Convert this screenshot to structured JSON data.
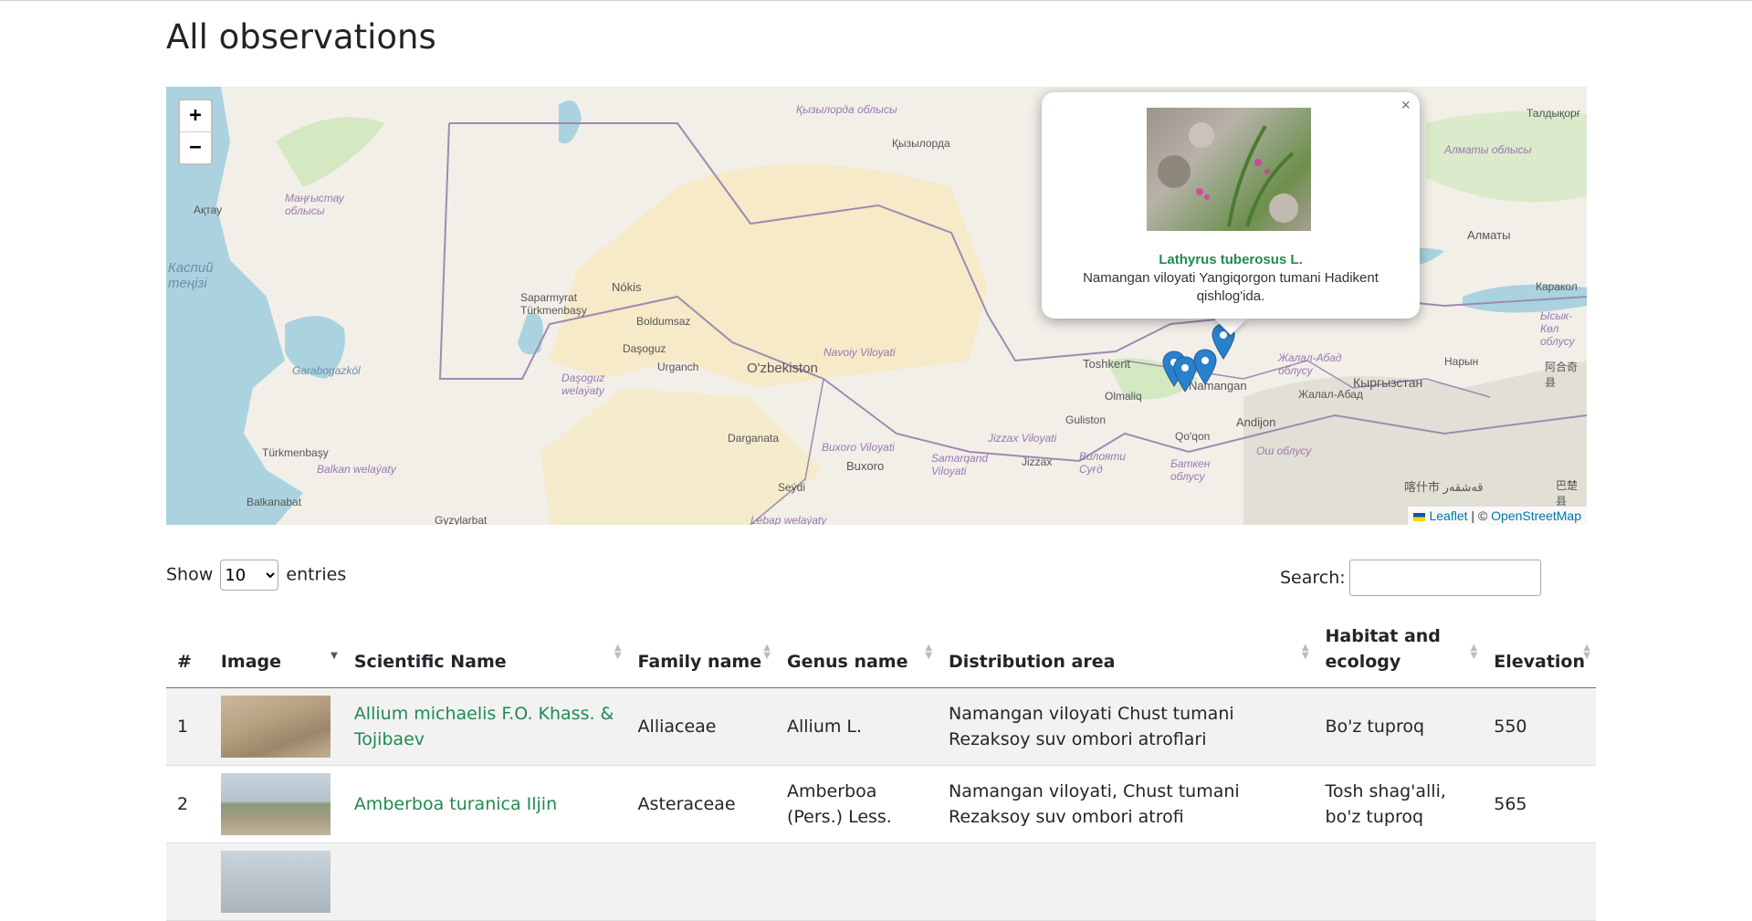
{
  "page": {
    "title": "All observations"
  },
  "map": {
    "zoom_in": "+",
    "zoom_out": "−",
    "attribution": {
      "leaflet": "Leaflet",
      "separator": " | © ",
      "osm": "OpenStreetMap"
    },
    "popup": {
      "close": "×",
      "title": "Lathyrus tuberosus L.",
      "description": "Namangan viloyati Yangiqorgon tumani Hadikent qishlog'ida."
    },
    "labels": [
      "Қызылорда облысы",
      "Қызылорда",
      "Талдықорғ",
      "Маңғыстау облысы",
      "Ақтау",
      "Алматы",
      "Алматы облысы",
      "Nókis",
      "Saparmyrat Türkmenbaşy",
      "Boldumsaz",
      "Daşoguz",
      "Urganch",
      "O'zbekiston",
      "Navoiy Viloyati",
      "Daşoguz welaýaty",
      "Garabogazköl",
      "Toshkent",
      "Olmaliq",
      "Namangan",
      "Andijon",
      "Жалал-Абад облусу",
      "Жалал-Абад",
      "Кыргызстан",
      "Нарын",
      "Каракол",
      "Ысык-Көл облусу",
      "Qo'qon",
      "Guliston",
      "Jizzax Viloyati",
      "Jizzax",
      "Samarqand Viloyati",
      "Buxoro Viloyati",
      "Buxoro",
      "Darganata",
      "Türkmenbaşy",
      "Balkan welaýaty",
      "Balkanabat",
      "Gyzylarbat",
      "Seýdi",
      "Lebap welaýaty",
      "Ош облусу",
      "Баткен облусу",
      "Вилояти Суғд",
      "喀什市 قەشقەر",
      "巴楚县",
      "阿合奇县",
      "Қызылорда",
      "Каспий теңізі"
    ]
  },
  "table_controls": {
    "show_label": "Show",
    "entries_label": "entries",
    "length_value": "10",
    "search_label": "Search:",
    "search_value": ""
  },
  "table": {
    "headers": [
      "#",
      "Image",
      "Scientific Name",
      "Family name",
      "Genus name",
      "Distribution area",
      "Habitat and ecology",
      "Elevation"
    ],
    "rows": [
      {
        "num": "1",
        "scientific_name": "Allium michaelis F.O. Khass. & Tojibaev",
        "family": "Alliaceae",
        "genus": "Allium L.",
        "distribution": "Namangan viloyati Chust tumani Rezaksoy suv ombori atroflari",
        "habitat": "Bo'z tuproq",
        "elevation": "550"
      },
      {
        "num": "2",
        "scientific_name": "Amberboa turanica Iljin",
        "family": "Asteraceae",
        "genus": "Amberboa (Pers.) Less.",
        "distribution": "Namangan viloyati, Chust tumani Rezaksoy suv ombori atrofi",
        "habitat": "Tosh shag'alli, bo'z tuproq",
        "elevation": "565"
      },
      {
        "num": "",
        "scientific_name": "",
        "family": "",
        "genus": "",
        "distribution": "",
        "habitat": "",
        "elevation": ""
      }
    ]
  },
  "colors": {
    "link": "#218a52",
    "water": "#aad3df",
    "desert": "#f7e9c0",
    "border": "#9e8bb0"
  }
}
